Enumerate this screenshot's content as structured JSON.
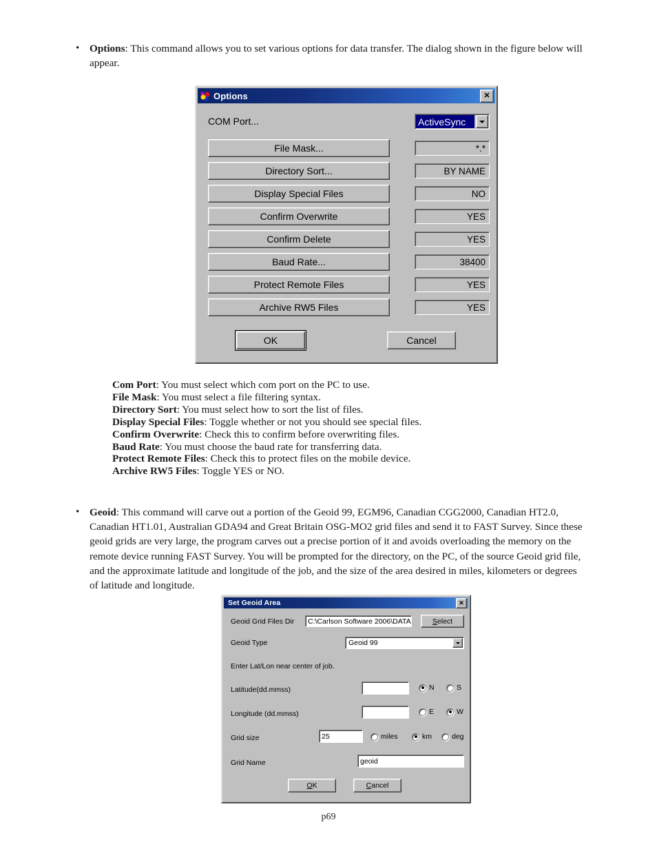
{
  "page": {
    "footer": "p69"
  },
  "options_section": {
    "bullet_marker": "•",
    "term": "Options",
    "text": ": This command allows you to set various options for data transfer. The dialog shown in the figure below will appear."
  },
  "options_dialog": {
    "title": "Options",
    "icon": "carlson-app-icon",
    "close_label": "✕",
    "com_port_label": "COM Port...",
    "com_port_value": "ActiveSync",
    "rows": [
      {
        "button": "File Mask...",
        "value": "*.*"
      },
      {
        "button": "Directory Sort...",
        "value": "BY NAME"
      },
      {
        "button": "Display Special Files",
        "value": "NO"
      },
      {
        "button": "Confirm Overwrite",
        "value": "YES"
      },
      {
        "button": "Confirm Delete",
        "value": "YES"
      },
      {
        "button": "Baud Rate...",
        "value": "38400"
      },
      {
        "button": "Protect Remote Files",
        "value": "YES"
      },
      {
        "button": "Archive RW5 Files",
        "value": "YES"
      }
    ],
    "ok_label": "OK",
    "cancel_label": "Cancel"
  },
  "descriptions": [
    {
      "term": "Com Port",
      "text": ":  You must select which com port on the PC to use."
    },
    {
      "term": "File Mask",
      "text": ":  You must select a file filtering syntax."
    },
    {
      "term": "Directory Sort",
      "text": ":  You must select how to sort the list of files."
    },
    {
      "term": "Display Special Files",
      "text": ":  Toggle whether or not you should see special files."
    },
    {
      "term": "Confirm Overwrite",
      "text": ": Check this to confirm before overwriting files."
    },
    {
      "term": "Baud Rate",
      "text": ":  You must choose the baud rate for transferring data."
    },
    {
      "term": "Protect Remote Files",
      "text": ": Check this to protect files on the mobile device."
    },
    {
      "term": "Archive RW5 Files",
      "text": ": Toggle YES or NO."
    }
  ],
  "geoid_section": {
    "bullet_marker": "•",
    "term": "Geoid",
    "text": ": This command will carve out a portion of the Geoid 99, EGM96, Canadian CGG2000, Canadian HT2.0, Canadian HT1.01, Australian GDA94 and Great Britain OSG-MO2 grid files and send it to FAST Survey.  Since these geoid grids are very large, the program carves out a precise portion of it and avoids overloading the memory on the remote device running FAST Survey. You will be prompted for the directory, on the PC, of the source Geoid grid file, and the approximate latitude and longitude of the job, and the size of the area desired in miles, kilometers or degrees of latitude and longitude."
  },
  "geoid_dialog": {
    "title": "Set Geoid Area",
    "close_label": "✕",
    "grid_dir_label": "Geoid Grid Files Dir",
    "grid_dir_value": "C:\\Carlson Software 2006\\DATA",
    "select_accel": "S",
    "select_rest": "elect",
    "geoid_type_label": "Geoid Type",
    "geoid_type_value": "Geoid 99",
    "hint": "Enter Lat/Lon near center of job.",
    "latitude_label": "Latitude(dd.mmss)",
    "latitude_value": "",
    "lat_n": "N",
    "lat_s": "S",
    "lat_selected": "N",
    "longitude_label": "Longitude (dd.mmss)",
    "longitude_value": "",
    "lon_e": "E",
    "lon_w": "W",
    "lon_selected": "W",
    "grid_size_label": "Grid size",
    "grid_size_value": "25",
    "unit_miles": "miles",
    "unit_km": "km",
    "unit_deg": "deg",
    "unit_selected": "km",
    "grid_name_label": "Grid Name",
    "grid_name_value": "geoid",
    "ok_accel": "O",
    "ok_rest": "K",
    "cancel_accel": "C",
    "cancel_rest": "ancel"
  }
}
